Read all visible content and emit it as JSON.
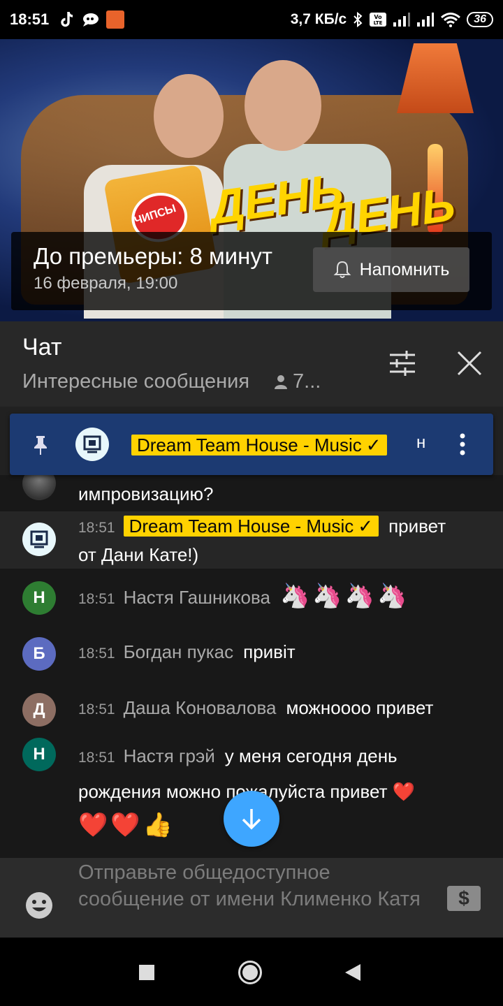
{
  "status_bar": {
    "time": "18:51",
    "speed": "3,7 КБ/с",
    "battery": "36",
    "icons": [
      "tiktok-icon",
      "chat-bubble-icon",
      "app-icon",
      "bluetooth-icon",
      "volte-icon",
      "signal-icon",
      "signal-icon",
      "wifi-icon",
      "battery-icon"
    ]
  },
  "video": {
    "thumbnail_text": [
      "ДЕНЬ",
      "ДЕНЬ"
    ],
    "chips_text": "ЧИПСЫ",
    "premiere_title": "До премьеры: 8 минут",
    "premiere_date": "16 февраля, 19:00",
    "remind_label": "Напомнить",
    "remind_icon": "bell-icon"
  },
  "chat": {
    "title": "Чат",
    "mode": "Интересные сообщения",
    "viewers": "7...",
    "filter_icon": "sliders-icon",
    "close_icon": "close-icon"
  },
  "pinned": {
    "author": "Dream Team House - Music",
    "trail": "н",
    "pin_icon": "pin-icon",
    "more_icon": "more-vert-icon"
  },
  "messages": [
    {
      "id": "partial",
      "text": "импровизацию?",
      "avatar_color": "#3a3a3a"
    },
    {
      "id": "owner",
      "time": "18:51",
      "author": "Dream Team House - Music",
      "text_part1": "привет",
      "text_part2": "от Дани Кате!)"
    },
    {
      "id": "m1",
      "time": "18:51",
      "author": "Настя Гашникова",
      "initial": "Н",
      "text": "🦄🦄🦄🦄",
      "avatar_color": "#2e7d32"
    },
    {
      "id": "m2",
      "time": "18:51",
      "author": "Богдан пукас",
      "initial": "Б",
      "text": "привіт",
      "avatar_color": "#5c6bc0"
    },
    {
      "id": "m3",
      "time": "18:51",
      "author": "Даша Коновалова",
      "initial": "Д",
      "text": "можноооо привет",
      "avatar_color": "#8d6e63"
    },
    {
      "id": "m4",
      "time": "18:51",
      "author": "Настя грэй",
      "initial": "Н",
      "text_part1": "у меня сегодня день",
      "text_part2": "рождения можно пожалуйста привет ❤️",
      "text_part3": "❤️❤️👍",
      "avatar_color": "#00695c"
    }
  ],
  "input": {
    "placeholder": "Отправьте общедоступное сообщение от имени Клименко Катя",
    "emoji_icon": "smile-icon",
    "super_chat_icon": "dollar-icon"
  },
  "colors": {
    "accent": "#3ea6ff",
    "owner_badge": "#ffd200",
    "pinned_bg": "#1c3a72"
  }
}
